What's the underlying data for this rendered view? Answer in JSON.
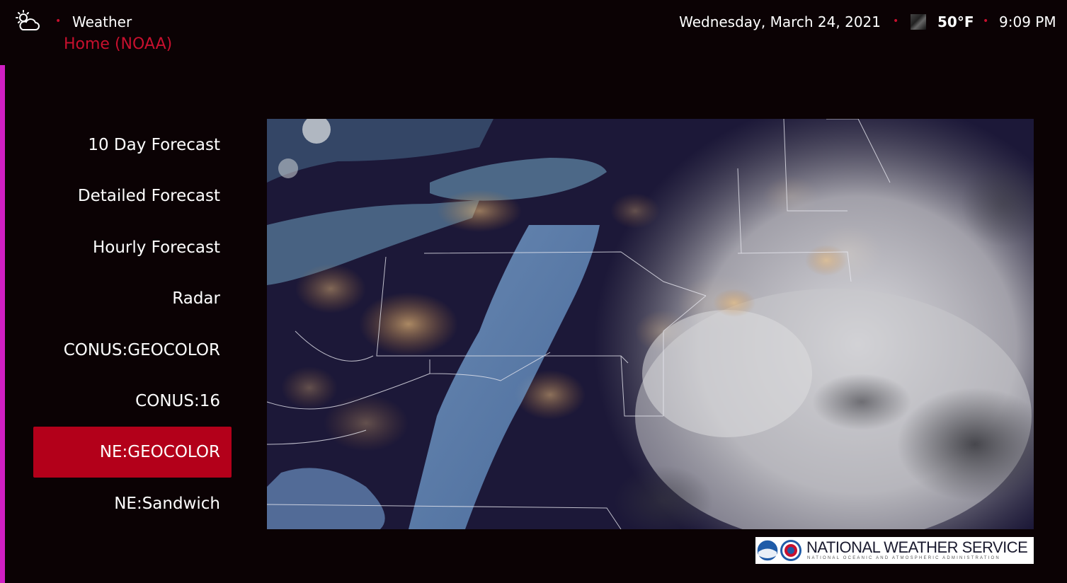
{
  "header": {
    "app_icon": "partly-cloudy-night-icon",
    "app_title": "Weather",
    "subtitle": "Home (NOAA)",
    "date": "Wednesday, March 24, 2021",
    "temperature": "50°F",
    "time": "9:09 PM",
    "separator": "•",
    "accent_color": "#c8102e"
  },
  "menu": {
    "items": [
      {
        "label": "10 Day Forecast",
        "selected": false
      },
      {
        "label": "Detailed Forecast",
        "selected": false
      },
      {
        "label": "Hourly Forecast",
        "selected": false
      },
      {
        "label": "Radar",
        "selected": false
      },
      {
        "label": "CONUS:GEOCOLOR",
        "selected": false
      },
      {
        "label": "CONUS:16",
        "selected": false
      },
      {
        "label": "NE:GEOCOLOR",
        "selected": true
      },
      {
        "label": "NE:Sandwich",
        "selected": false
      }
    ],
    "selected_color": "#b3001a"
  },
  "logo": {
    "title": "NATIONAL WEATHER SERVICE",
    "subtitle": "NATIONAL OCEANIC AND ATMOSPHERIC ADMINISTRATION"
  }
}
